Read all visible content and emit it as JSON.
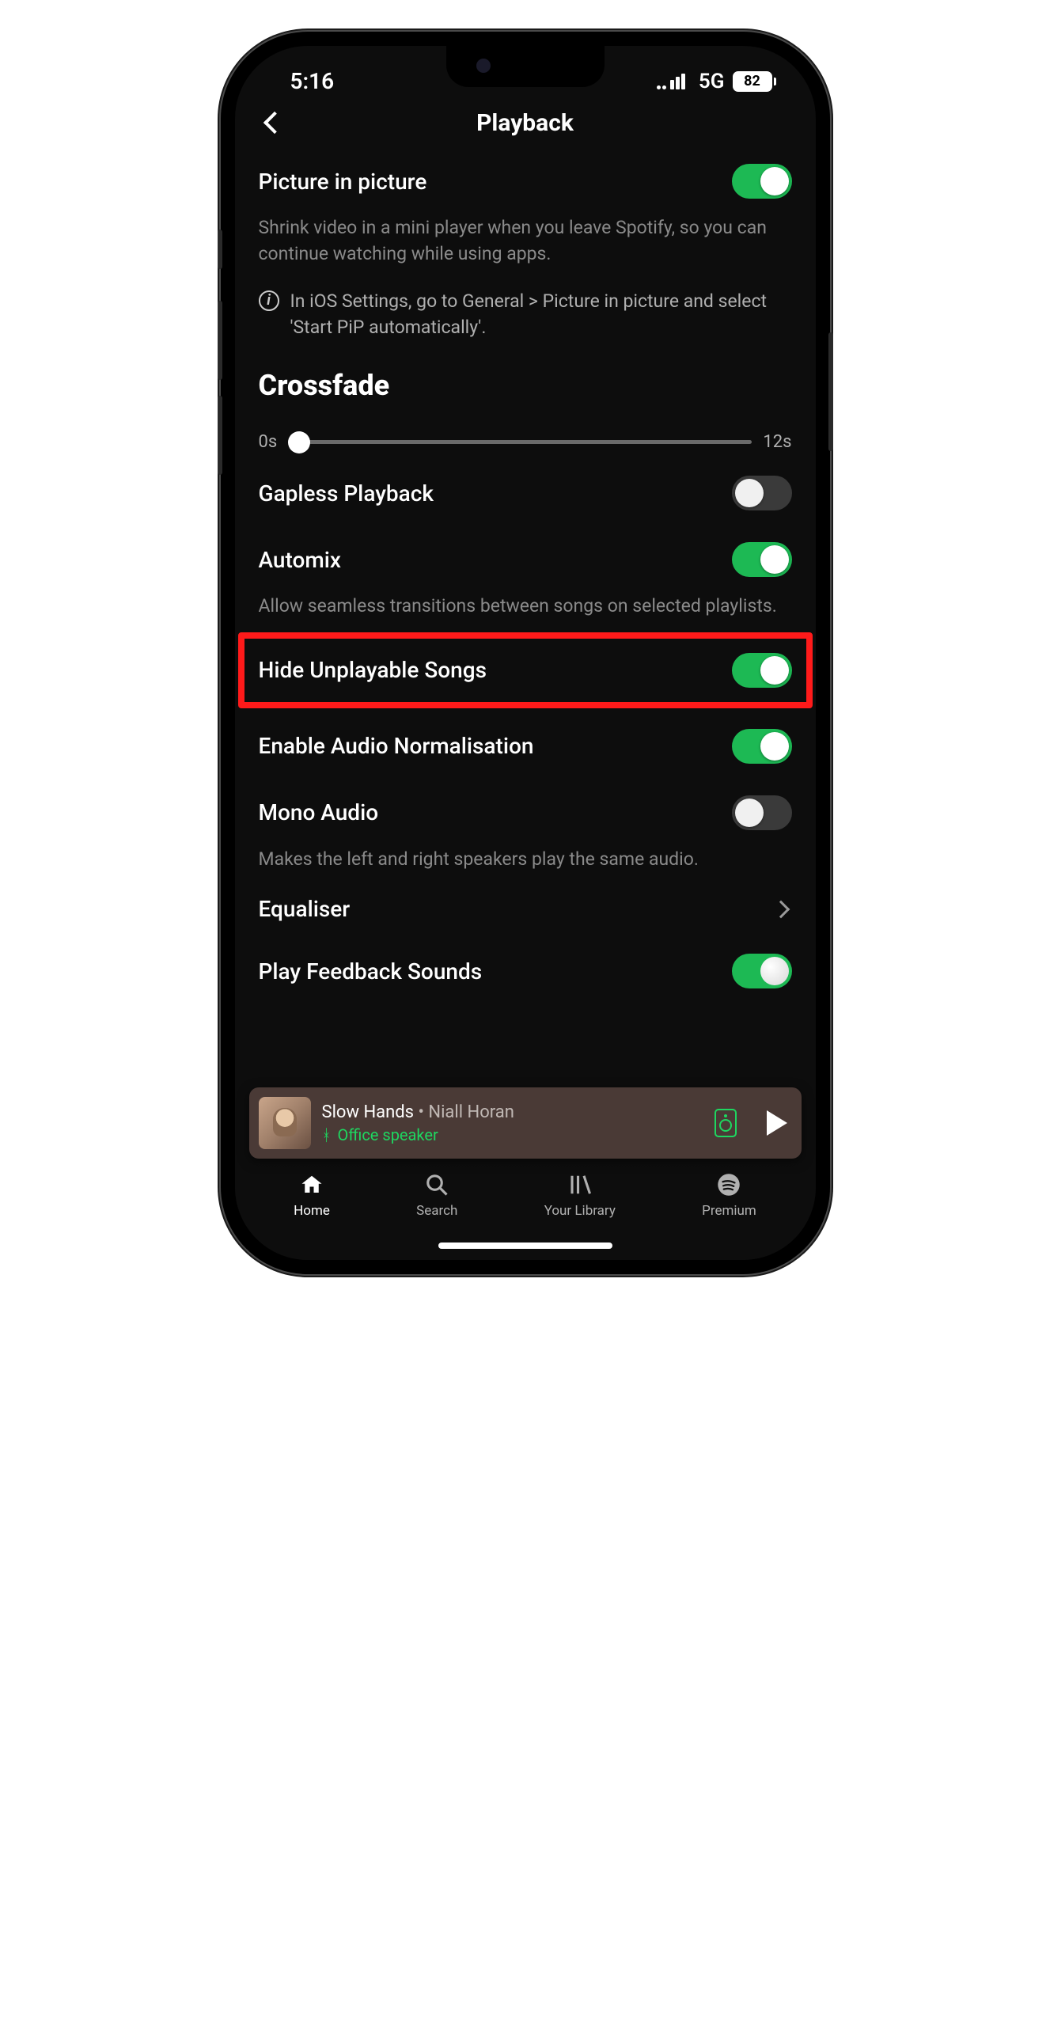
{
  "status": {
    "time": "5:16",
    "network": "5G",
    "battery": "82"
  },
  "header": {
    "title": "Playback"
  },
  "pip": {
    "title": "Picture in picture",
    "desc": "Shrink video in a mini player when you leave Spotify, so you can continue watching while using apps.",
    "info": "In iOS Settings, go to General > Picture in picture and select 'Start PiP automatically'.",
    "enabled": true
  },
  "crossfade": {
    "title": "Crossfade",
    "min_label": "0s",
    "max_label": "12s",
    "value": 0
  },
  "items": {
    "gapless": {
      "title": "Gapless Playback",
      "enabled": false
    },
    "automix": {
      "title": "Automix",
      "desc": "Allow seamless transitions between songs on selected playlists.",
      "enabled": true
    },
    "hide_unplayable": {
      "title": "Hide Unplayable Songs",
      "enabled": true
    },
    "normalisation": {
      "title": "Enable Audio Normalisation",
      "enabled": true
    },
    "mono": {
      "title": "Mono Audio",
      "desc": "Makes the left and right speakers play the same audio.",
      "enabled": false
    },
    "equaliser": {
      "title": "Equaliser"
    },
    "feedback": {
      "title": "Play Feedback Sounds",
      "enabled": true
    }
  },
  "now_playing": {
    "track": "Slow Hands",
    "separator": " • ",
    "artist": "Niall Horan",
    "device": "Office speaker"
  },
  "tabs": {
    "home": "Home",
    "search": "Search",
    "library": "Your Library",
    "premium": "Premium"
  }
}
